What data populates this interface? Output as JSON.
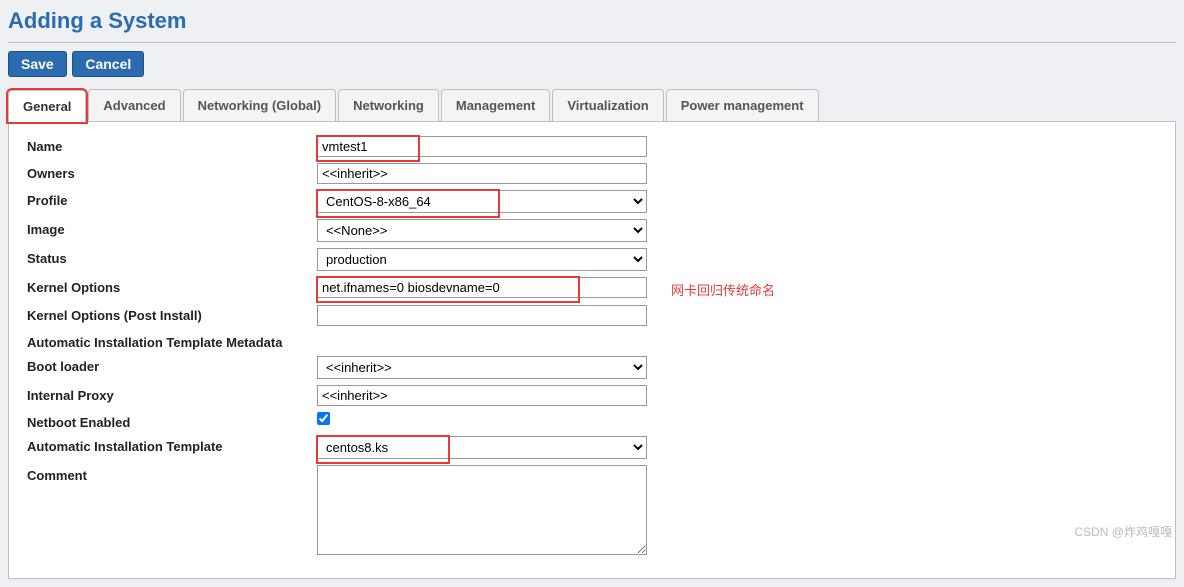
{
  "page": {
    "title": "Adding a System"
  },
  "buttons": {
    "save": "Save",
    "cancel": "Cancel"
  },
  "tabs": {
    "general": "General",
    "advanced": "Advanced",
    "networking_global": "Networking (Global)",
    "networking": "Networking",
    "management": "Management",
    "virtualization": "Virtualization",
    "power_management": "Power management"
  },
  "fields": {
    "name": {
      "label": "Name",
      "value": "vmtest1"
    },
    "owners": {
      "label": "Owners",
      "value": "<<inherit>>"
    },
    "profile": {
      "label": "Profile",
      "value": "CentOS-8-x86_64"
    },
    "image": {
      "label": "Image",
      "value": "<<None>>"
    },
    "status": {
      "label": "Status",
      "value": "production"
    },
    "kernel_options": {
      "label": "Kernel Options",
      "value": "net.ifnames=0 biosdevname=0"
    },
    "kernel_options_post": {
      "label": "Kernel Options (Post Install)",
      "value": ""
    },
    "autoinstall_meta": {
      "label": "Automatic Installation Template Metadata",
      "value": ""
    },
    "boot_loader": {
      "label": "Boot loader",
      "value": "<<inherit>>"
    },
    "internal_proxy": {
      "label": "Internal Proxy",
      "value": "<<inherit>>"
    },
    "netboot_enabled": {
      "label": "Netboot Enabled",
      "checked": true
    },
    "autoinstall_template": {
      "label": "Automatic Installation Template",
      "value": "centos8.ks"
    },
    "comment": {
      "label": "Comment",
      "value": ""
    }
  },
  "annotations": {
    "kernel_note": "网卡回归传统命名"
  },
  "watermark": "CSDN @炸鸡嘎嘎"
}
